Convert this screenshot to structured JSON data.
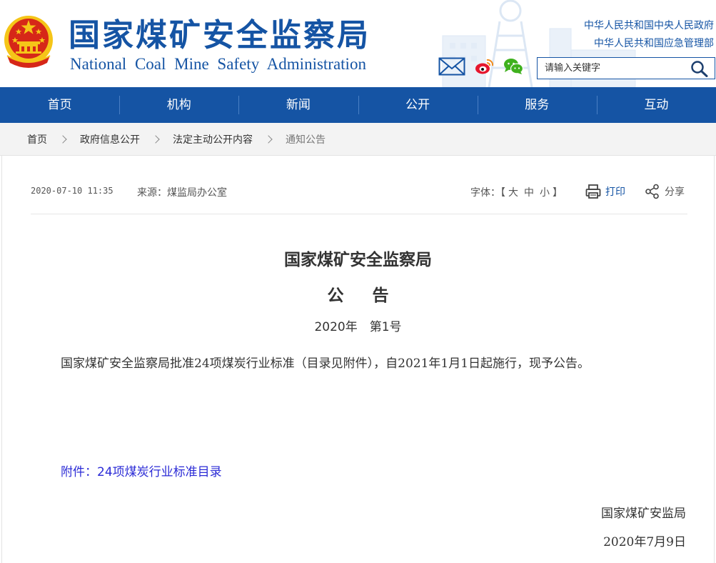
{
  "header": {
    "title_cn": "国家煤矿安全监察局",
    "title_en": "National Coal Mine Safety Administration",
    "gov_links": [
      {
        "label": "中华人民共和国中央人民政府"
      },
      {
        "label": "中华人民共和国应急管理部"
      }
    ],
    "share_icons": [
      "mail-icon",
      "weibo-icon",
      "wechat-icon"
    ],
    "search": {
      "placeholder": "请输入关键字",
      "value": ""
    },
    "colors": {
      "brand": "#1554a4",
      "emblem_red": "#d62718",
      "emblem_gold": "#f5c518"
    }
  },
  "nav": {
    "items": [
      {
        "label": "首页"
      },
      {
        "label": "机构"
      },
      {
        "label": "新闻"
      },
      {
        "label": "公开"
      },
      {
        "label": "服务"
      },
      {
        "label": "互动"
      }
    ]
  },
  "breadcrumb": {
    "items": [
      {
        "label": "首页"
      },
      {
        "label": "政府信息公开"
      },
      {
        "label": "法定主动公开内容"
      },
      {
        "label": "通知公告"
      }
    ]
  },
  "meta": {
    "date": "2020-07-10 11:35",
    "source": "来源：煤监局办公室",
    "font_size_label": "字体：",
    "font_bracket_open": "【",
    "font_sizes": [
      "大",
      "中",
      "小"
    ],
    "font_bracket_close": "】",
    "print_label": "打印",
    "share_label": "分享"
  },
  "article": {
    "org_title": "国家煤矿安全监察局",
    "doc_type": "公告",
    "doc_number": "2020年　第1号",
    "body": "国家煤矿安全监察局批准24项煤炭行业标准（目录见附件），自2021年1月1日起施行，现予公告。",
    "attachment": "附件：24项煤炭行业标准目录",
    "signature_org": "国家煤矿安监局",
    "signature_date": "2020年7月9日"
  }
}
